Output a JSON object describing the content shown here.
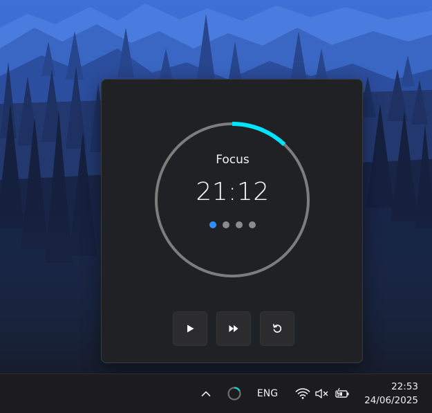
{
  "timer": {
    "session_label": "Focus",
    "time_remaining": "21:12",
    "progress": 0.12,
    "sessions": [
      {
        "active": true
      },
      {
        "active": false
      },
      {
        "active": false
      },
      {
        "active": false
      }
    ],
    "ring_color": "#00e5ff",
    "track_color": "#7d7d7d"
  },
  "controls": [
    {
      "name": "play-button",
      "icon": "play-icon"
    },
    {
      "name": "skip-button",
      "icon": "fast-forward-icon"
    },
    {
      "name": "reset-button",
      "icon": "restart-icon"
    }
  ],
  "taskbar": {
    "language": "ENG",
    "time": "22:53",
    "date": "24/06/2025",
    "icons": [
      "chevron-up-icon",
      "timer-app-icon",
      "wifi-icon",
      "speaker-muted-icon",
      "battery-charging-icon"
    ]
  }
}
